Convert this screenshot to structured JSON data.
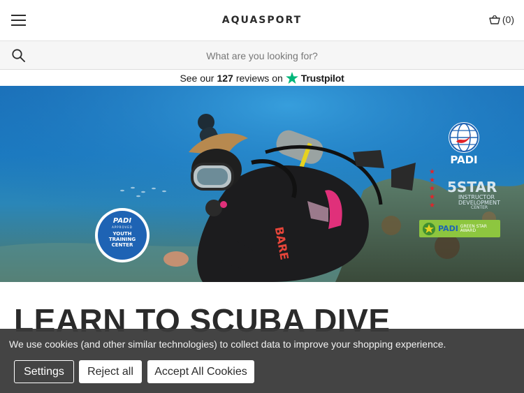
{
  "header": {
    "logo": "AQUASPORT",
    "cart_label": "(0)"
  },
  "search": {
    "placeholder": "What are you looking for?"
  },
  "trustbar": {
    "prefix": "See our",
    "count": "127",
    "suffix": "reviews on",
    "brand": "Trustpilot"
  },
  "hero": {
    "badge_youth": {
      "brand": "PADI",
      "approved": "APPROVED",
      "line1": "YOUTH",
      "line2": "TRAINING",
      "line3": "CENTER"
    },
    "padi_logo": "PADI",
    "five_star": "5STAR",
    "five_star_sub1": "INSTRUCTOR",
    "five_star_sub2": "DEVELOPMENT",
    "five_star_sub3": "CENTER",
    "green_star_brand": "PADI",
    "green_star_line1": "GREEN STAR",
    "green_star_line2": "AWARD",
    "suit_brand": "BARE"
  },
  "main": {
    "title": "LEARN TO SCUBA DIVE"
  },
  "cookie": {
    "message": "We use cookies (and other similar technologies) to collect data to improve your shopping experience.",
    "settings": "Settings",
    "reject": "Reject all",
    "accept": "Accept All Cookies"
  },
  "colors": {
    "trustpilot_green": "#00b67a",
    "padi_blue": "#1e63b4",
    "padi_red": "#e2232a",
    "cookie_bg": "#3a3a3a"
  }
}
